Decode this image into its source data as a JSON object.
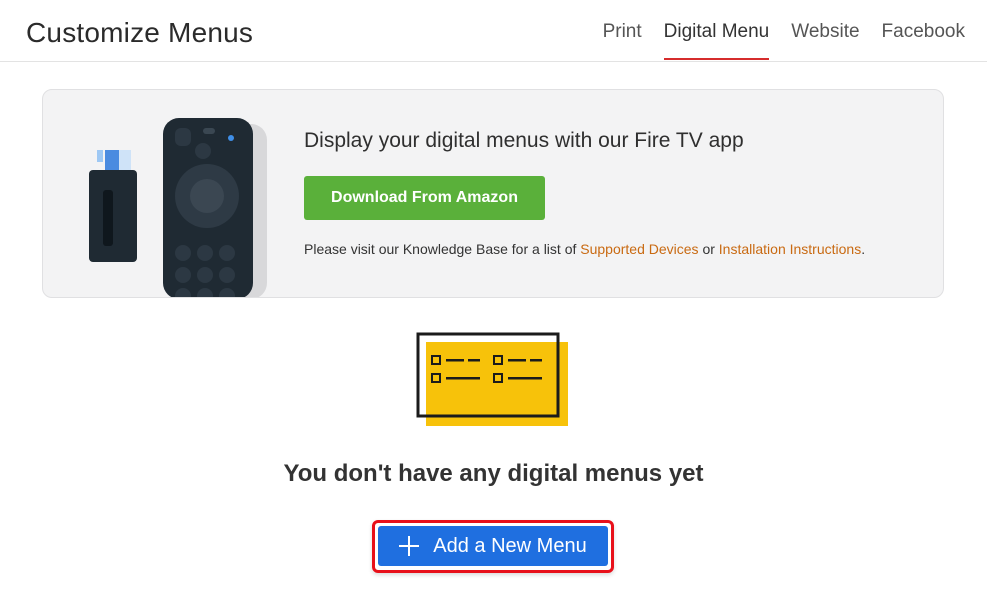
{
  "header": {
    "title": "Customize Menus",
    "tabs": [
      {
        "label": "Print",
        "active": false
      },
      {
        "label": "Digital Menu",
        "active": true
      },
      {
        "label": "Website",
        "active": false
      },
      {
        "label": "Facebook",
        "active": false
      }
    ]
  },
  "banner": {
    "heading": "Display your digital menus with our Fire TV app",
    "button_label": "Download From Amazon",
    "note_prefix": "Please visit our Knowledge Base for a list of ",
    "link_devices": "Supported Devices",
    "note_middle": " or ",
    "link_install": "Installation Instructions",
    "note_suffix": "."
  },
  "empty_state": {
    "message": "You don't have any digital menus yet",
    "add_button_label": "Add a New Menu"
  },
  "colors": {
    "accent_red": "#d62c2c",
    "button_green": "#5ab03a",
    "button_blue": "#1f6fe0",
    "link_orange": "#c96a12",
    "illustration_yellow": "#f7c20a"
  },
  "icons": [
    "fire-tv-stick-icon",
    "fire-tv-remote-icon",
    "menu-card-illustration",
    "plus-icon"
  ]
}
